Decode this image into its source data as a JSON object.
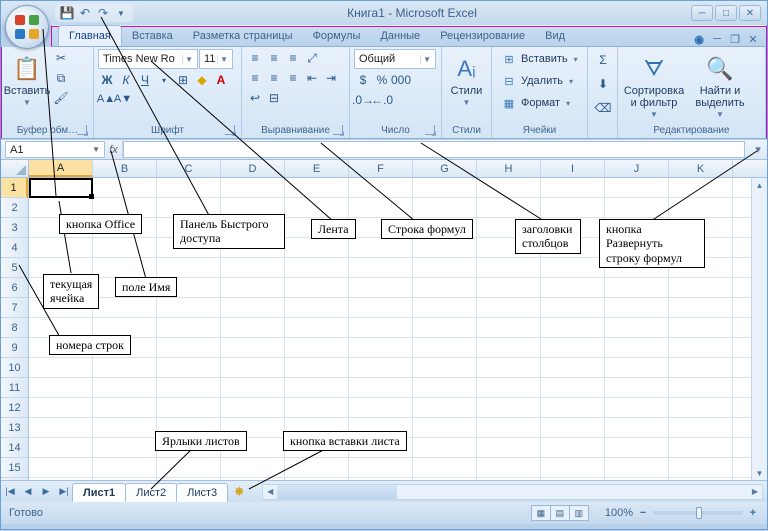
{
  "title": {
    "doc": "Книга1",
    "app": "Microsoft Excel"
  },
  "tabs": [
    "Главная",
    "Вставка",
    "Разметка страницы",
    "Формулы",
    "Данные",
    "Рецензирование",
    "Вид"
  ],
  "ribbon": {
    "clipboard": {
      "paste": "Вставить",
      "label": "Буфер обм…"
    },
    "font": {
      "name": "Times New Ro",
      "size": "11",
      "label": "Шрифт"
    },
    "align": {
      "label": "Выравнивание"
    },
    "number": {
      "format": "Общий",
      "label": "Число"
    },
    "styles": {
      "btn": "Стили",
      "label": "Стили"
    },
    "cells": {
      "insert": "Вставить",
      "delete": "Удалить",
      "format": "Формат",
      "label": "Ячейки"
    },
    "editing": {
      "sort": "Сортировка и фильтр",
      "find": "Найти и выделить",
      "label": "Редактирование"
    }
  },
  "namebox": "A1",
  "columns": [
    "A",
    "B",
    "C",
    "D",
    "E",
    "F",
    "G",
    "H",
    "I",
    "J",
    "K"
  ],
  "rows": [
    "1",
    "2",
    "3",
    "4",
    "5",
    "6",
    "7",
    "8",
    "9",
    "10",
    "11",
    "12",
    "13",
    "14",
    "15"
  ],
  "sheets": [
    "Лист1",
    "Лист2",
    "Лист3"
  ],
  "status": {
    "ready": "Готово",
    "zoom": "100%"
  },
  "annotations": {
    "office": "кнопка Office",
    "qat": "Панель Быстрого доступа",
    "ribbon": "Лента",
    "formulabar": "Строка формул",
    "colheaders": "заголовки столбцов",
    "expand": "кнопка Развернуть строку формул",
    "active": "текущая ячейка",
    "namebox": "поле Имя",
    "rownums": "номера строк",
    "sheettabs": "Ярлыки листов",
    "newsheet": "кнопка вставки листа"
  }
}
